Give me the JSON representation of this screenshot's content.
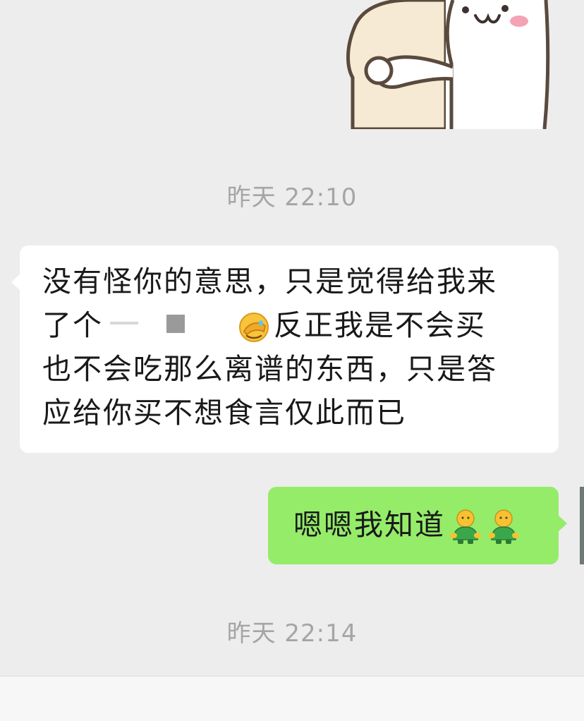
{
  "sticker": {
    "icon": "cartoon-bunny-hug-sticker"
  },
  "timestamps": {
    "first": "昨天 22:10",
    "second": "昨天 22:14"
  },
  "messages": [
    {
      "direction": "received",
      "line1": "没有怪你的意思，只是觉得给我来",
      "line2_prefix": "了个",
      "line2_icon": "face-palm-emoji",
      "line2_suffix": "反正我是不会买",
      "line3": "也不会吃那么离谱的东西，只是答",
      "line4": "应给你买不想食言仅此而已"
    },
    {
      "direction": "sent",
      "text": "嗯嗯我知道",
      "icon": "person-emoji"
    }
  ],
  "colors": {
    "background": "#ededed",
    "received_bubble": "#ffffff",
    "sent_bubble": "#95ec69",
    "timestamp": "#a5a5a5",
    "text": "#191919"
  }
}
